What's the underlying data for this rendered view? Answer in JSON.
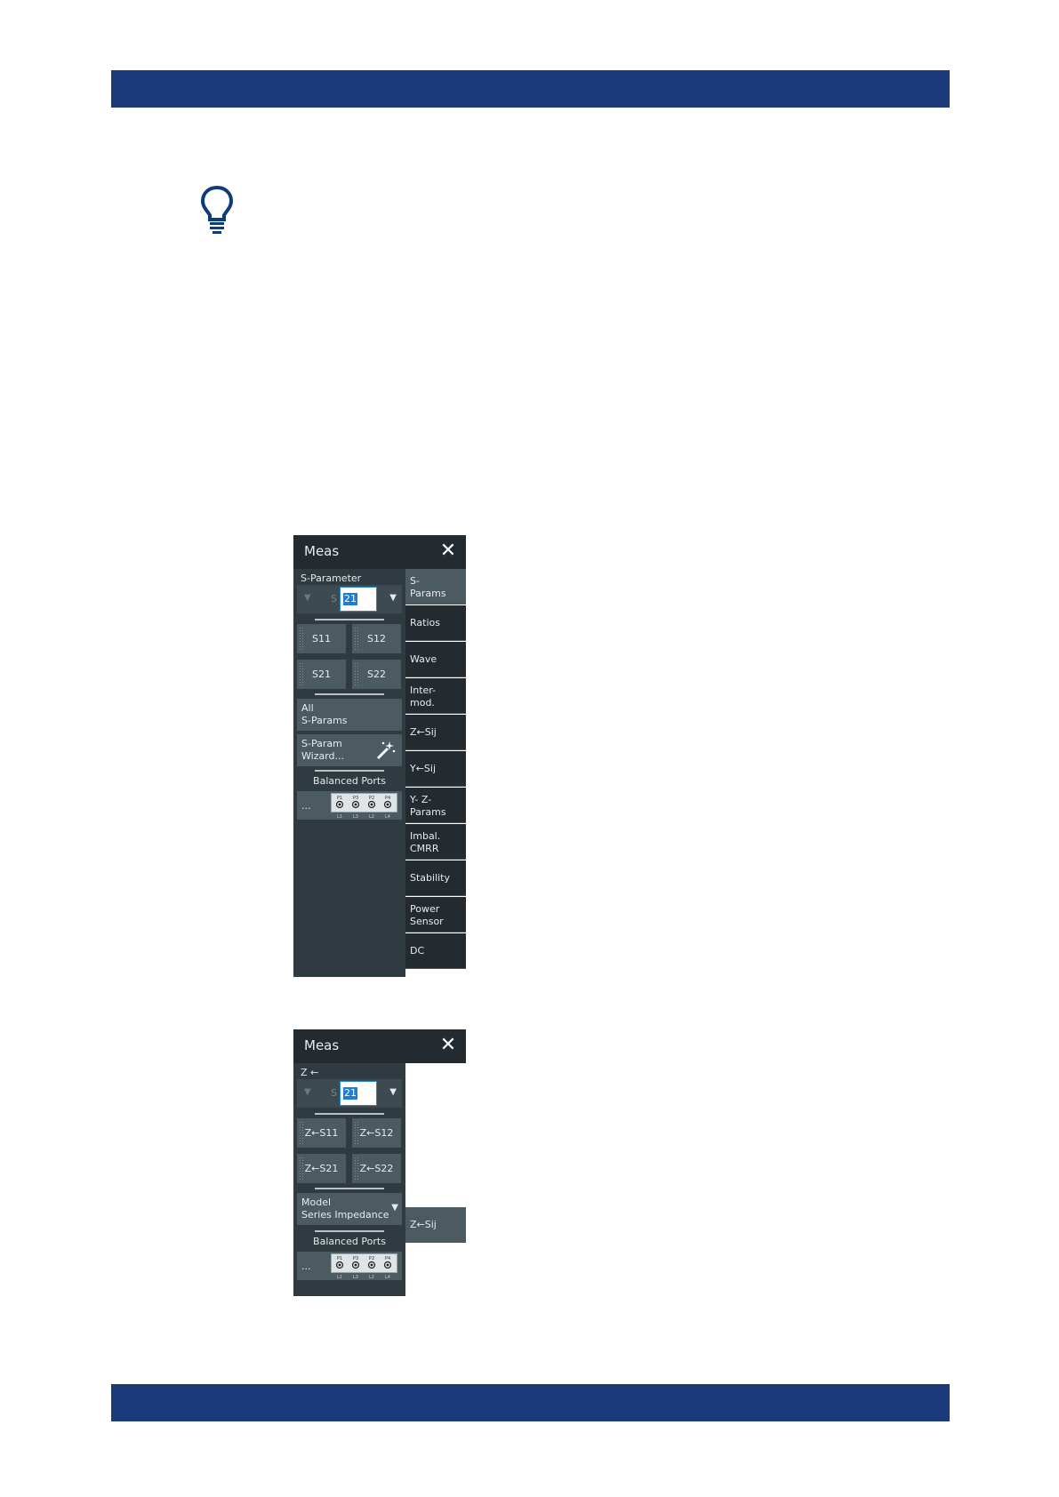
{
  "colors": {
    "band": "#1b3a7a",
    "tip_icon": "#0f3d7a",
    "panel_dark": "#232b31",
    "panel": "#2f3a41",
    "button": "#4c5a62",
    "selection": "#1e7ed6"
  },
  "icons": {
    "tip": "lightbulb-icon",
    "close": "close-icon",
    "wizard": "magic-wand-icon",
    "dropdown": "chevron-down-icon",
    "ports": "balanced-ports-icon"
  },
  "meas_dialog_1": {
    "title": "Meas",
    "close_glyph": "✕",
    "section_title": "S-Parameter",
    "selector": {
      "prefix": "S",
      "value": "21"
    },
    "buttons": [
      "S11",
      "S12",
      "S21",
      "S22"
    ],
    "all_sparams": {
      "line1": "All",
      "line2": "S-Params"
    },
    "wizard": {
      "line1": "S-Param",
      "line2": "Wizard..."
    },
    "balanced_title": "Balanced Ports",
    "balanced_dots": "...",
    "ports": {
      "top": [
        "P1",
        "P3",
        "P2",
        "P4"
      ],
      "bottom": [
        "L1",
        "L3",
        "L2",
        "L4"
      ]
    },
    "tabs": [
      {
        "line1": "S-",
        "line2": "Params"
      },
      {
        "line1": "Ratios",
        "line2": ""
      },
      {
        "line1": "Wave",
        "line2": ""
      },
      {
        "line1": "Inter-",
        "line2": "mod."
      },
      {
        "line1": "Z←Sij",
        "line2": ""
      },
      {
        "line1": "Y←Sij",
        "line2": ""
      },
      {
        "line1": "Y- Z-",
        "line2": "Params"
      },
      {
        "line1": "Imbal.",
        "line2": "CMRR"
      },
      {
        "line1": "Stability",
        "line2": ""
      },
      {
        "line1": "Power",
        "line2": "Sensor"
      },
      {
        "line1": "DC",
        "line2": ""
      }
    ]
  },
  "meas_dialog_2": {
    "title": "Meas",
    "close_glyph": "✕",
    "section_title": "Z ←",
    "selector": {
      "prefix": "S",
      "value": "21"
    },
    "buttons": [
      "Z←S11",
      "Z←S12",
      "Z←S21",
      "Z←S22"
    ],
    "model": {
      "line1": "Model",
      "line2": "Series Impedance"
    },
    "balanced_title": "Balanced Ports",
    "balanced_dots": "...",
    "ports": {
      "top": [
        "P1",
        "P3",
        "P2",
        "P4"
      ],
      "bottom": [
        "L1",
        "L3",
        "L2",
        "L4"
      ]
    },
    "tab": "Z←Sij"
  }
}
